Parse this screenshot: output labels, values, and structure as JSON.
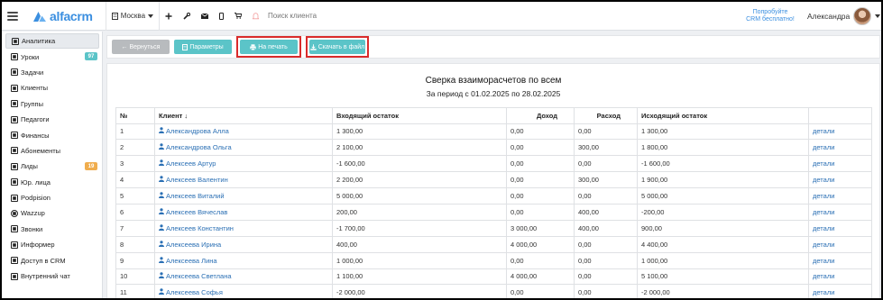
{
  "header": {
    "app_name": "alfacrm",
    "city": "Москва",
    "search_placeholder": "Поиск клиента",
    "promo_line1": "Попробуйте",
    "promo_line2": "CRM бесплатно!",
    "user_name": "Александра",
    "accent_color": "#3b8fe0"
  },
  "sidebar": {
    "items": [
      {
        "label": "Аналитика",
        "icon": "chart-icon",
        "active": true
      },
      {
        "label": "Уроки",
        "icon": "calendar-icon",
        "badge": "97",
        "badge_color": "#5bc4c8"
      },
      {
        "label": "Задачи",
        "icon": "tasks-icon"
      },
      {
        "label": "Клиенты",
        "icon": "user-icon"
      },
      {
        "label": "Группы",
        "icon": "users-icon"
      },
      {
        "label": "Педагоги",
        "icon": "graduation-cap-icon"
      },
      {
        "label": "Финансы",
        "icon": "money-icon"
      },
      {
        "label": "Абонементы",
        "icon": "ticket-icon"
      },
      {
        "label": "Лиды",
        "icon": "user-plus-icon",
        "badge": "19",
        "badge_color": "#f0ad4e"
      },
      {
        "label": "Юр. лица",
        "icon": "building-icon"
      },
      {
        "label": "Podpision",
        "icon": "document-icon"
      },
      {
        "label": "Wazzup",
        "icon": "whatsapp-icon"
      },
      {
        "label": "Звонки",
        "icon": "phone-icon"
      },
      {
        "label": "Информер",
        "icon": "informer-icon"
      },
      {
        "label": "Доступ в CRM",
        "icon": "lock-icon"
      },
      {
        "label": "Внутренний чат",
        "icon": "chat-icon"
      }
    ]
  },
  "toolbar": {
    "back_label": "← Вернуться",
    "params_label": "Параметры",
    "print_label": "На печать",
    "download_label": "Скачать в файл"
  },
  "report": {
    "title": "Сверка взаиморасчетов по всем",
    "period": "За период с 01.02.2025 по 28.02.2025",
    "columns": {
      "num": "№",
      "client": "Клиент ↓",
      "opening": "Входящий остаток",
      "income": "Доход",
      "expense": "Расход",
      "closing": "Исходящий остаток",
      "details": ""
    },
    "rows": [
      {
        "num": "1",
        "client": "Александрова Алла",
        "opening": "1 300,00",
        "income": "0,00",
        "expense": "0,00",
        "closing": "1 300,00",
        "details": "детали"
      },
      {
        "num": "2",
        "client": "Александрова Ольга",
        "opening": "2 100,00",
        "income": "0,00",
        "expense": "300,00",
        "closing": "1 800,00",
        "details": "детали"
      },
      {
        "num": "3",
        "client": "Алексеев Артур",
        "opening": "-1 600,00",
        "income": "0,00",
        "expense": "0,00",
        "closing": "-1 600,00",
        "details": "детали"
      },
      {
        "num": "4",
        "client": "Алексеев Валентин",
        "opening": "2 200,00",
        "income": "0,00",
        "expense": "300,00",
        "closing": "1 900,00",
        "details": "детали"
      },
      {
        "num": "5",
        "client": "Алексеев Виталий",
        "opening": "5 000,00",
        "income": "0,00",
        "expense": "0,00",
        "closing": "5 000,00",
        "details": "детали"
      },
      {
        "num": "6",
        "client": "Алексеев Вячеслав",
        "opening": "200,00",
        "income": "0,00",
        "expense": "400,00",
        "closing": "-200,00",
        "details": "детали"
      },
      {
        "num": "7",
        "client": "Алексеев Константин",
        "opening": "-1 700,00",
        "income": "3 000,00",
        "expense": "400,00",
        "closing": "900,00",
        "details": "детали"
      },
      {
        "num": "8",
        "client": "Алексеева Ирина",
        "opening": "400,00",
        "income": "4 000,00",
        "expense": "0,00",
        "closing": "4 400,00",
        "details": "детали"
      },
      {
        "num": "9",
        "client": "Алексеева Лина",
        "opening": "1 000,00",
        "income": "0,00",
        "expense": "0,00",
        "closing": "1 000,00",
        "details": "детали"
      },
      {
        "num": "10",
        "client": "Алексеева Светлана",
        "opening": "1 100,00",
        "income": "4 000,00",
        "expense": "0,00",
        "closing": "5 100,00",
        "details": "детали"
      },
      {
        "num": "11",
        "client": "Алексеева Софья",
        "opening": "-2 000,00",
        "income": "0,00",
        "expense": "0,00",
        "closing": "-2 000,00",
        "details": "детали"
      }
    ]
  }
}
